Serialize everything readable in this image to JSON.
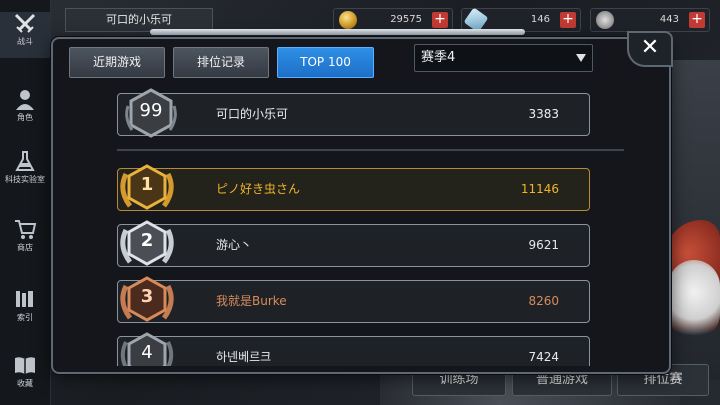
{
  "top": {
    "player_name": "可口的小乐可",
    "resources": [
      {
        "icon": "coin-icon",
        "value": "29575"
      },
      {
        "icon": "crystal-icon",
        "value": "146"
      },
      {
        "icon": "paw-token-icon",
        "value": "443"
      }
    ]
  },
  "nav": [
    {
      "label": "战斗",
      "icon": "crossed-swords-icon"
    },
    {
      "label": "角色",
      "icon": "character-icon"
    },
    {
      "label": "科技实验室",
      "icon": "flask-icon"
    },
    {
      "label": "商店",
      "icon": "cart-icon"
    },
    {
      "label": "索引",
      "icon": "bookshelf-icon"
    },
    {
      "label": "收藏",
      "icon": "book-icon"
    }
  ],
  "dialog": {
    "tabs": [
      "近期游戏",
      "排位记录",
      "TOP 100"
    ],
    "active_tab": "TOP 100",
    "season": "赛季4",
    "self_row": {
      "rank": "99",
      "name": "可口的小乐可",
      "score": "3383"
    },
    "rows": [
      {
        "rank": "1",
        "name": "ピノ好き虫さん",
        "score": "11146",
        "tier": "gold"
      },
      {
        "rank": "2",
        "name": "游心丶",
        "score": "9621",
        "tier": "silver"
      },
      {
        "rank": "3",
        "name": "我就是Burke",
        "score": "8260",
        "tier": "bronze"
      },
      {
        "rank": "4",
        "name": "하넨베르크",
        "score": "7424",
        "tier": "plain"
      }
    ]
  },
  "bottom_buttons": [
    "训练场",
    "普通游戏",
    "排位赛"
  ],
  "colors": {
    "gold": "#f0b42a",
    "bronze": "#d88a5b",
    "accent": "#2f8fe6"
  }
}
